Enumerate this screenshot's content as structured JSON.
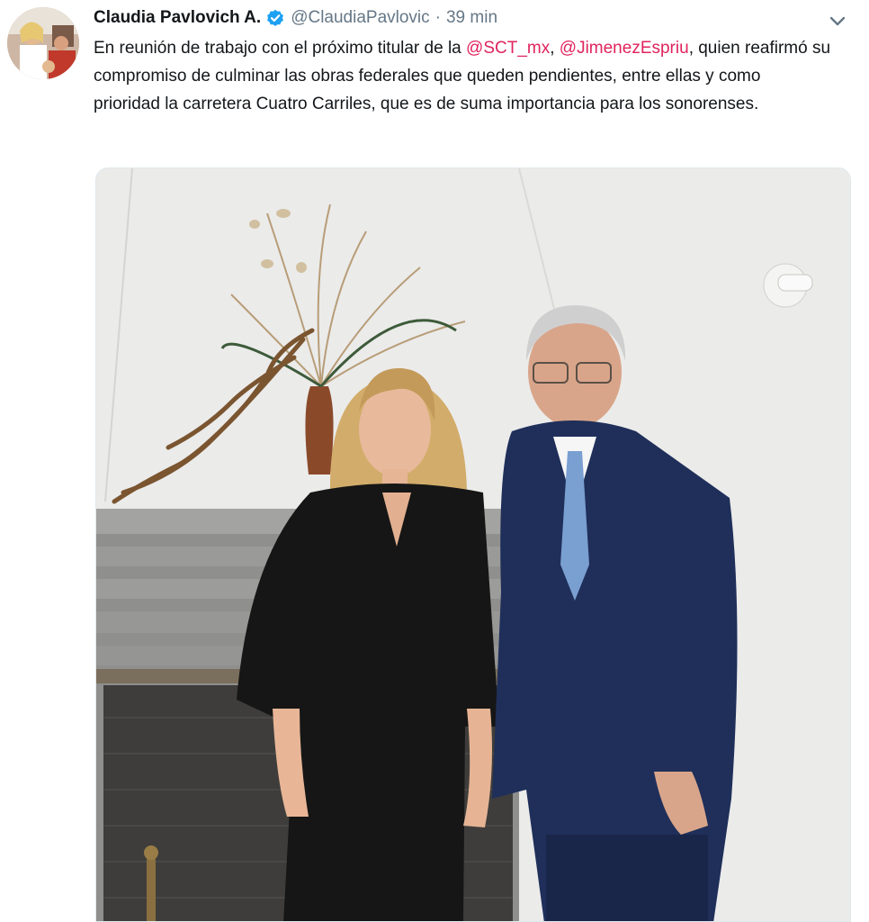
{
  "tweet": {
    "display_name": "Claudia Pavlovich A.",
    "handle": "@ClaudiaPavlovic",
    "separator": "·",
    "time": "39 min",
    "text": {
      "part1": "En reunión de trabajo con el próximo titular de la ",
      "mention1": "@SCT_mx",
      "part2": ", ",
      "mention2": "@JimenezEspriu",
      "part3": ", quien reafirmó su compromiso de culminar las obras federales que queden pendientes, entre ellas y como prioridad la carretera Cuatro Carriles, que es de suma importancia para los sonorenses."
    }
  },
  "icons": {
    "verified": "verified-badge-icon",
    "caret": "chevron-down-icon"
  },
  "colors": {
    "mention": "#e0245e",
    "verified": "#1da1f2",
    "secondary_text": "#657786",
    "primary_text": "#14171a"
  }
}
